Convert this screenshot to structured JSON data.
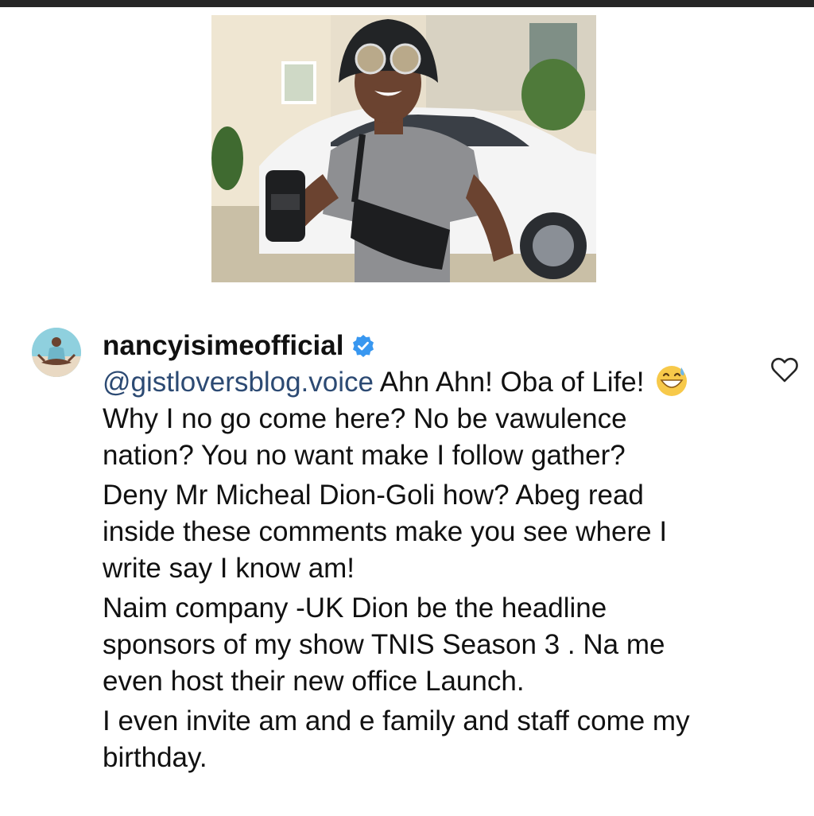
{
  "post": {
    "image_description_icon": "photo"
  },
  "comment": {
    "username": "nancyisimeofficial",
    "verified_icon": "verified-badge-icon",
    "mention": "@gistloversblog.voice",
    "line1_rest": " Ahn Ahn! Oba of Life!",
    "emoji_icon": "grinning-sweat-emoji-icon",
    "line1_after_emoji": "Why I no go come here? No be vawulence nation? You no want make I follow gather?",
    "paragraph2": "Deny Mr Micheal Dion-Goli how? Abeg read inside these comments make you see where I write say I know am!",
    "paragraph3": "Naim company -UK Dion be the headline sponsors of my show TNIS Season 3 . Na me even host their new office Launch.",
    "paragraph4": "I even invite am and e family and staff come my birthday."
  },
  "actions": {
    "like_icon": "heart-outline-icon"
  },
  "colors": {
    "mention": "#2c4a73",
    "verified": "#3897f0",
    "text": "#111111",
    "top_bar": "#262626"
  }
}
